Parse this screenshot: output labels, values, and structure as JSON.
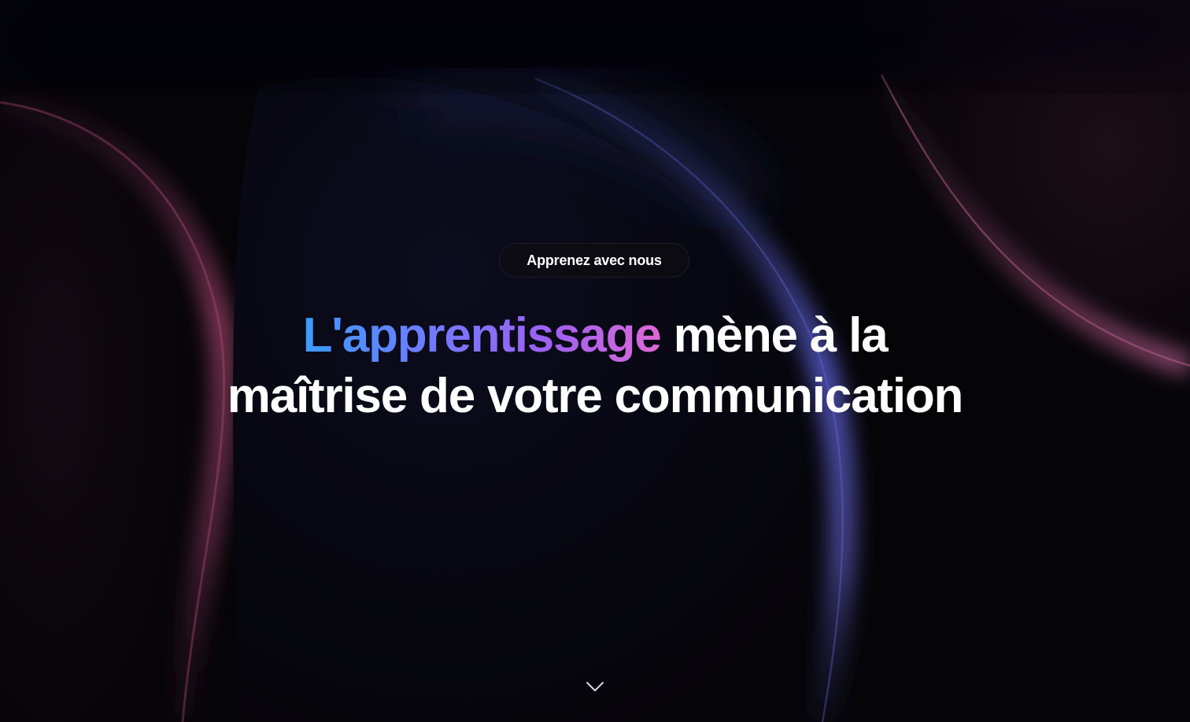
{
  "hero": {
    "badge_label": "Apprenez avec nous",
    "headline_highlight": "L'apprentissage",
    "headline_rest_line1": "mène à la",
    "headline_line2": "maîtrise de votre communication",
    "scroll_icon": "chevron-down-icon"
  },
  "colors": {
    "background": "#050407",
    "text": "#ffffff",
    "gradient_start": "#3d9bff",
    "gradient_mid": "#a060f0",
    "gradient_end": "#de6ad6",
    "glow_pink": "#c0507e",
    "glow_blue": "#5f63d6"
  }
}
